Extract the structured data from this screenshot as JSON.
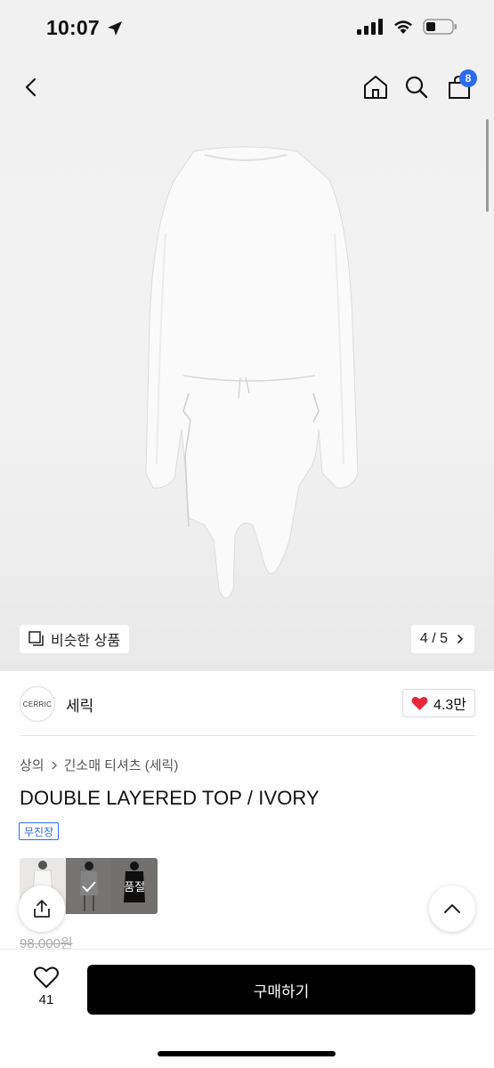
{
  "status_bar": {
    "time": "10:07",
    "location_icon": "location-arrow-icon",
    "signal_icon": "cellular-signal-icon",
    "wifi_icon": "wifi-icon",
    "battery_icon": "battery-icon",
    "battery_level": 0.3
  },
  "nav": {
    "back_icon": "chevron-left-icon",
    "home_icon": "home-icon",
    "search_icon": "search-icon",
    "cart_icon": "shopping-bag-icon",
    "cart_count": "8"
  },
  "gallery": {
    "similar_label": "비슷한 상품",
    "counter": "4 / 5"
  },
  "brand": {
    "logo_text": "CERRIC",
    "name": "세릭",
    "likes": "4.3만"
  },
  "breadcrumb": {
    "category": "상의",
    "subcategory": "긴소매 티셔츠 (세릭)"
  },
  "product": {
    "title": "DOUBLE LAYERED TOP / IVORY",
    "badge": "무진장",
    "thumbnail_sold_out": "품절",
    "original_price": "98,000원"
  },
  "bottom_bar": {
    "wish_count": "41",
    "buy_label": "구매하기"
  },
  "colors": {
    "accent_blue": "#2d6cf0",
    "heart_red": "#e8283a",
    "buy_button": "#000000"
  }
}
